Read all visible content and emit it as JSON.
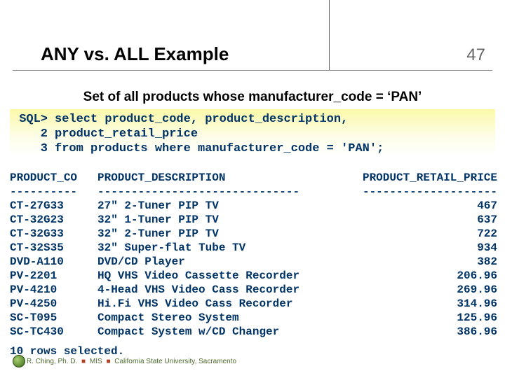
{
  "page_number": "47",
  "title": "ANY vs. ALL Example",
  "subtitle": "Set of all products whose manufacturer_code = ‘PAN’",
  "sql": {
    "lines": [
      {
        "gutter": "SQL>",
        "text": "select product_code, product_description,"
      },
      {
        "gutter": "2",
        "text": "product_retail_price"
      },
      {
        "gutter": "3",
        "text": "from products where manufacturer_code = 'PAN';"
      }
    ]
  },
  "result": {
    "headers": {
      "c1": "PRODUCT_CO",
      "c2": "PRODUCT_DESCRIPTION",
      "c3": "PRODUCT_RETAIL_PRICE"
    },
    "dashes": {
      "c1": "----------",
      "c2": "------------------------------",
      "c3": "--------------------"
    },
    "rows": [
      {
        "c1": "CT-27G33",
        "c2": "27\" 2-Tuner PIP TV",
        "c3": "467"
      },
      {
        "c1": "CT-32G23",
        "c2": "32\" 1-Tuner PIP TV",
        "c3": "637"
      },
      {
        "c1": "CT-32G33",
        "c2": "32\" 2-Tuner PIP TV",
        "c3": "722"
      },
      {
        "c1": "CT-32S35",
        "c2": "32\" Super-flat Tube TV",
        "c3": "934"
      },
      {
        "c1": "DVD-A110",
        "c2": "DVD/CD Player",
        "c3": "382"
      },
      {
        "c1": "PV-2201",
        "c2": "HQ VHS Video Cassette Recorder",
        "c3": "206.96"
      },
      {
        "c1": "PV-4210",
        "c2": "4-Head VHS Video Cass Recorder",
        "c3": "269.96"
      },
      {
        "c1": "PV-4250",
        "c2": "Hi.Fi VHS Video Cass Recorder",
        "c3": "314.96"
      },
      {
        "c1": "SC-T095",
        "c2": "Compact Stereo System",
        "c3": "125.96"
      },
      {
        "c1": "SC-TC430",
        "c2": "Compact System w/CD Changer",
        "c3": "386.96"
      }
    ],
    "rowcount": "10 rows selected."
  },
  "footer": {
    "author": "R. Ching, Ph. D.",
    "dept": "MIS",
    "org": "California State University, Sacramento"
  }
}
